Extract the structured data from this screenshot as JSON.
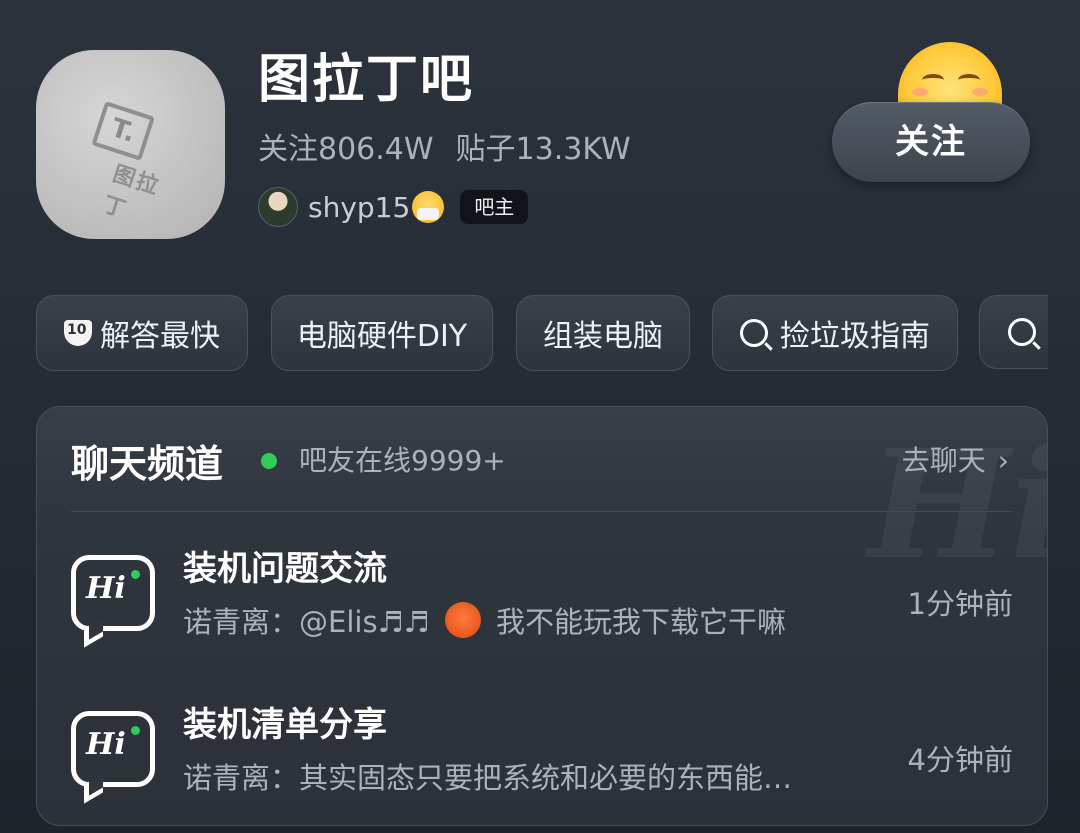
{
  "forum": {
    "title": "图拉丁吧",
    "logo_t": "T.",
    "logo_text": "图拉丁",
    "followers": "关注806.4W",
    "posts": "贴子13.3KW",
    "admin_name": "shyp15",
    "admin_role": "吧主",
    "follow_label": "关注"
  },
  "tags": [
    {
      "label": "解答最快",
      "icon": "trophy-10-icon"
    },
    {
      "label": "电脑硬件DIY"
    },
    {
      "label": "组装电脑"
    },
    {
      "label": "捡垃圾指南",
      "icon": "search-icon"
    },
    {
      "label": "",
      "icon": "search-icon"
    }
  ],
  "chat": {
    "title": "聊天频道",
    "online": "吧友在线9999+",
    "go_label": "去聊天",
    "go_chevron": "›",
    "watermark": "Hi",
    "rooms": [
      {
        "name": "装机问题交流",
        "msg_prefix": "诺青离：@Elis♬♬",
        "msg_suffix": "我不能玩我下载它干嘛",
        "time": "1分钟前",
        "icon_text": "Hi"
      },
      {
        "name": "装机清单分享",
        "msg_prefix": "诺青离：其实固态只要把系统和必要的东西能…",
        "msg_suffix": "",
        "time": "4分钟前",
        "icon_text": "Hi"
      }
    ]
  },
  "colors": {
    "background": "#262c35",
    "online_dot": "#2ecc58",
    "text_secondary": "#aab2bc"
  }
}
